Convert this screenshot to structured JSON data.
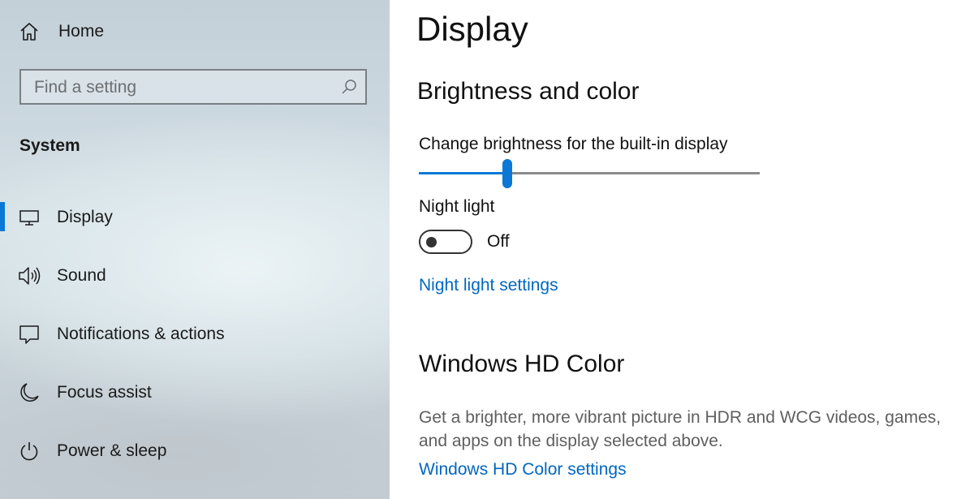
{
  "sidebar": {
    "home_label": "Home",
    "search": {
      "placeholder": "Find a setting",
      "value": ""
    },
    "section_title": "System",
    "active_item": "Display",
    "items": [
      {
        "label": "Display",
        "icon": "monitor-icon"
      },
      {
        "label": "Sound",
        "icon": "speaker-icon"
      },
      {
        "label": "Notifications & actions",
        "icon": "notification-icon"
      },
      {
        "label": "Focus assist",
        "icon": "moon-icon"
      },
      {
        "label": "Power & sleep",
        "icon": "power-icon"
      }
    ]
  },
  "main": {
    "title": "Display",
    "brightness_section": {
      "heading": "Brightness and color",
      "slider_label": "Change brightness for the built-in display",
      "brightness_fraction": 0.26
    },
    "night_light": {
      "label": "Night light",
      "state": "Off",
      "settings_link": "Night light settings"
    },
    "hd_color": {
      "heading": "Windows HD Color",
      "description": "Get a brighter, more vibrant picture in HDR and WCG videos, games, and apps on the display selected above.",
      "settings_link": "Windows HD Color settings"
    }
  },
  "colors": {
    "accent": "#0a78d6",
    "link": "#0067c0"
  }
}
